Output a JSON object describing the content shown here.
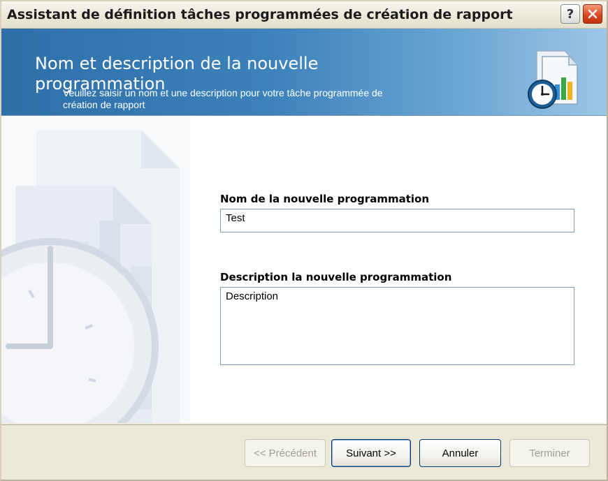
{
  "window": {
    "title": "Assistant de définition tâches programmées de création de rapport",
    "help_label": "?"
  },
  "banner": {
    "title": "Nom et description de la nouvelle programmation",
    "subtitle": "Veuillez saisir un nom et une description pour votre tâche programmée de création de rapport",
    "icon": "report-schedule-icon"
  },
  "form": {
    "name_label": "Nom de la nouvelle programmation",
    "name_value": "Test",
    "description_label": "Description la nouvelle programmation",
    "description_value": "Description"
  },
  "footer": {
    "previous_label": "<< Précédent",
    "next_label": "Suivant >>",
    "cancel_label": "Annuler",
    "finish_label": "Terminer"
  },
  "colors": {
    "banner_start": "#2e6fa8",
    "banner_end": "#9cc6e6",
    "close_button": "#d6441c",
    "input_border": "#7f9db9"
  }
}
